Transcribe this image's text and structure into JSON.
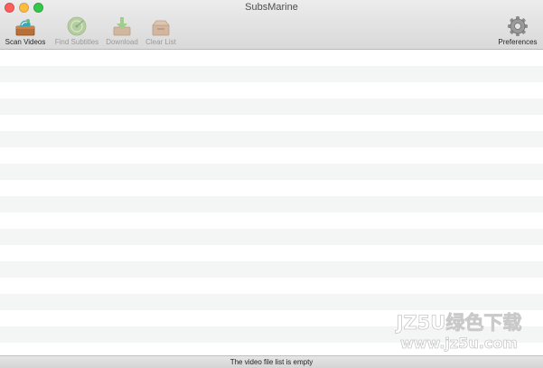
{
  "window": {
    "title": "SubsMarine"
  },
  "toolbar": {
    "scan_videos": "Scan Videos",
    "find_subtitles": "Find Subtitles",
    "download": "Download",
    "clear_list": "Clear List",
    "preferences": "Preferences"
  },
  "list": {
    "row_count": 19
  },
  "status": {
    "text": "The video file list is empty"
  },
  "watermark": {
    "line1": "JZ5U绿色下载",
    "line2": "www.jz5u.com"
  },
  "colors": {
    "row_alt": "#f4f5f5",
    "close": "#fc605c",
    "minimize": "#fdbc40",
    "maximize": "#34c84a"
  }
}
